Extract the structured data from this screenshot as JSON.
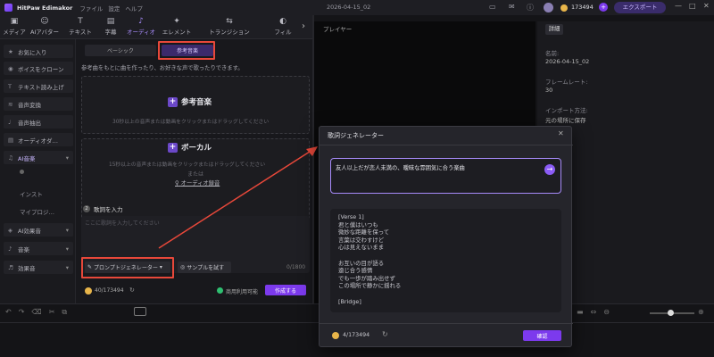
{
  "app": {
    "name": "HitPaw Edimakor",
    "menus": [
      "ファイル",
      "設定",
      "ヘルプ"
    ],
    "project": "2026-04-15_02",
    "credits": "173494",
    "export": "エクスポート"
  },
  "toolbar": [
    {
      "label": "メディア",
      "icon": "▣"
    },
    {
      "label": "AIアバター",
      "icon": "☺"
    },
    {
      "label": "テキスト",
      "icon": "T"
    },
    {
      "label": "字幕",
      "icon": "▤"
    },
    {
      "label": "オーディオ",
      "icon": "♪",
      "active": true
    },
    {
      "label": "エレメント",
      "icon": "✦"
    },
    {
      "label": "トランジション",
      "icon": "⇆"
    },
    {
      "label": "フィル",
      "icon": "◐"
    }
  ],
  "leftnav": {
    "items": [
      "お気に入り",
      "ボイスをクローン",
      "テキスト読み上げ",
      "音声変換",
      "音声抽出",
      "オーディオダ…",
      "AI音楽"
    ],
    "subitems": [
      "インスト",
      "マイプロジ…"
    ],
    "bottom": [
      "AI効果音",
      "音楽",
      "効果音"
    ]
  },
  "center": {
    "tabs": [
      "ベーシック",
      "参考音楽"
    ],
    "hint": "参考曲をもとに曲を作ったり、お好きな声で歌ったりできます。",
    "ref": {
      "title": "参考音楽",
      "desc": "30秒以上の音声または動画をクリックまたはドラッグしてください"
    },
    "vocal": {
      "title": "ボーカル",
      "desc": "15秒以上の音声または動画をクリックまたはドラッグしてください",
      "or": "または",
      "record": "オーディオ録音"
    },
    "lyrics_label": "歌詞を入力",
    "lyrics_placeholder": "ここに歌詞を入力してください",
    "prompt_gen": "プロンプトジェネレーター",
    "sample": "サンプルを試す",
    "count": "0/1800",
    "credits": "40/173494",
    "commercial": "商用利用可能",
    "create": "作成する"
  },
  "player": {
    "title": "プレイヤー"
  },
  "details": {
    "tab": "詳細",
    "name_label": "名前:",
    "name_value": "2026-04-15_02",
    "fps_label": "フレームレート:",
    "fps_value": "30",
    "import_label": "インポート方法:",
    "import_value": "元の場所に保存"
  },
  "dialog": {
    "title": "歌詞ジェネレーター",
    "prompt": "友人以上だが恋人未満の、曖昧な雰囲気に合う楽曲",
    "lyrics": "[Verse 1]\n君と僕はいつも\n微妙な距離を保って\n言葉は交わすけど\n心は見えないまま\n\nお互いの目が語る\n遠じ合う感情\nでも一歩が踏み出せず\nこの場所で静かに揺れる\n\n[Bridge]",
    "credits": "4/173494",
    "confirm": "確認"
  },
  "colors": {
    "accent": "#7c3aed",
    "highlight": "#e8483a"
  }
}
